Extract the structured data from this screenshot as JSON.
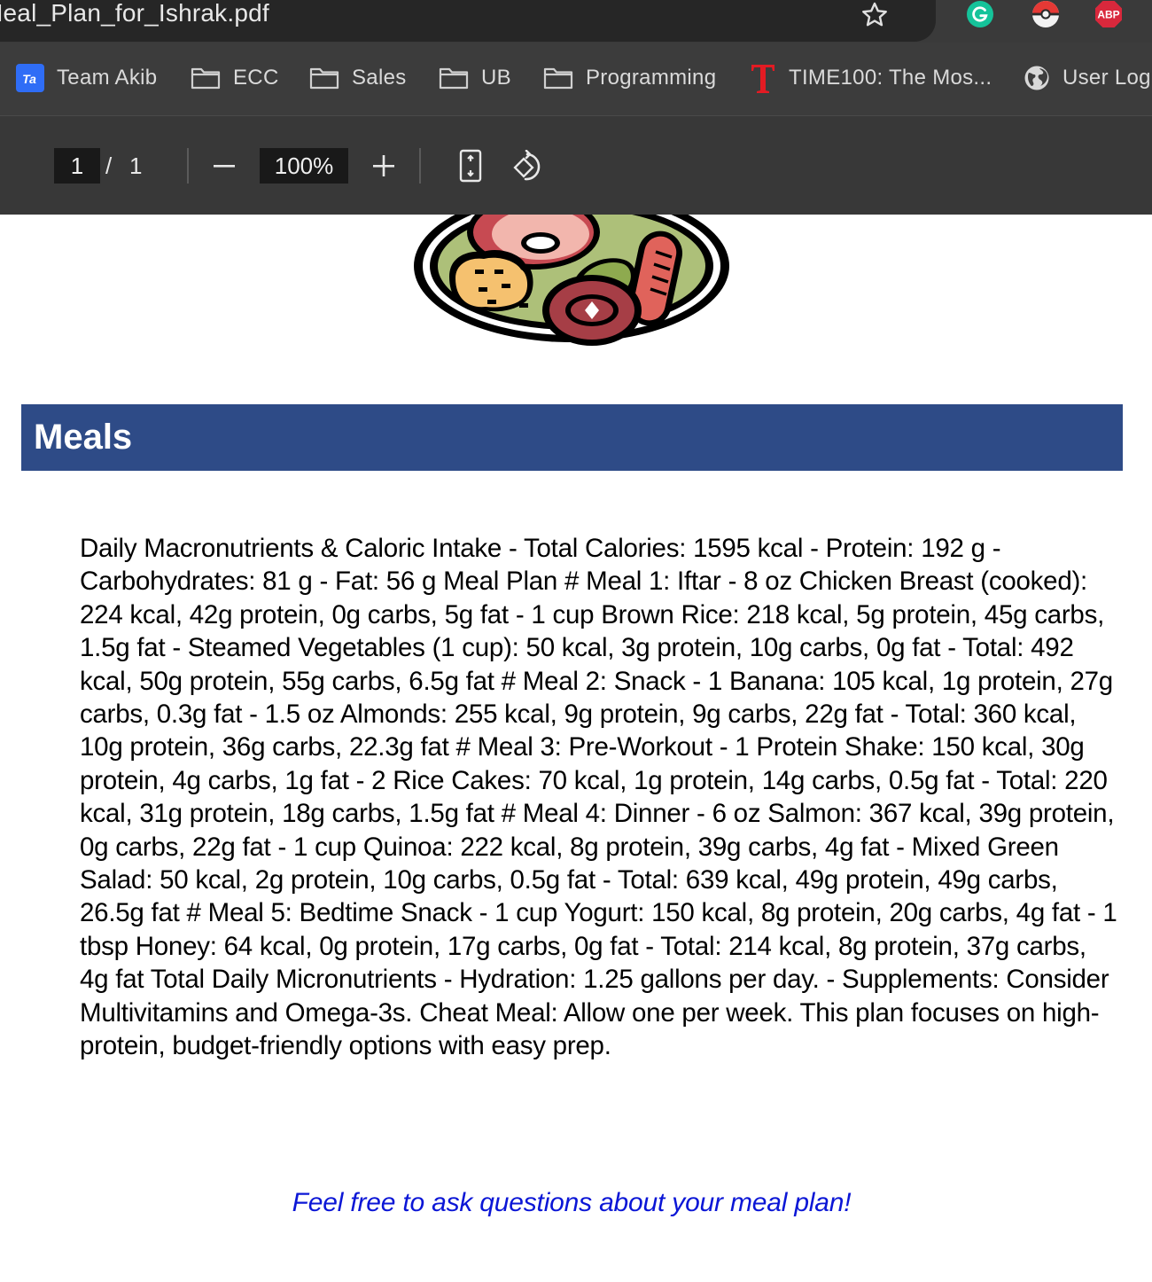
{
  "browser": {
    "address_text": "Meal_Plan_for_Ishrak.pdf",
    "extensions": {
      "grammarly": "G",
      "adblock": "ABP"
    }
  },
  "bookmarks": [
    {
      "label": "Team Akib",
      "icon": "team-akib-icon"
    },
    {
      "label": "ECC",
      "icon": "folder-icon"
    },
    {
      "label": "Sales",
      "icon": "folder-icon"
    },
    {
      "label": "UB",
      "icon": "folder-icon"
    },
    {
      "label": "Programming",
      "icon": "folder-icon"
    },
    {
      "label": "TIME100: The Mos...",
      "icon": "time-logo-icon"
    },
    {
      "label": "User Log",
      "icon": "globe-icon"
    }
  ],
  "pdf_toolbar": {
    "current_page": "1",
    "page_separator": "/",
    "total_pages": "1",
    "zoom": "100%"
  },
  "document": {
    "section_title": "Meals",
    "body": "Daily Macronutrients & Caloric Intake - Total Calories: 1595 kcal - Protein: 192 g - Carbohydrates: 81 g - Fat: 56 g Meal Plan # Meal 1: Iftar - 8 oz Chicken Breast (cooked): 224 kcal, 42g protein, 0g carbs, 5g fat - 1 cup Brown Rice: 218 kcal, 5g protein, 45g carbs, 1.5g fat - Steamed Vegetables (1 cup): 50 kcal, 3g protein, 10g carbs, 0g fat - Total: 492 kcal, 50g protein, 55g carbs, 6.5g fat # Meal 2: Snack - 1 Banana: 105 kcal, 1g protein, 27g carbs, 0.3g fat - 1.5 oz Almonds: 255 kcal, 9g protein, 9g carbs, 22g fat - Total: 360 kcal, 10g protein, 36g carbs, 22.3g fat # Meal 3: Pre-Workout - 1 Protein Shake: 150 kcal, 30g protein, 4g carbs, 1g fat - 2 Rice Cakes: 70 kcal, 1g protein, 14g carbs, 0.5g fat - Total: 220 kcal, 31g protein, 18g carbs, 1.5g fat # Meal 4: Dinner - 6 oz Salmon: 367 kcal, 39g protein, 0g carbs, 22g fat - 1 cup Quinoa: 222 kcal, 8g protein, 39g carbs, 4g fat - Mixed Green Salad: 50 kcal, 2g protein, 10g carbs, 0.5g fat - Total: 639 kcal, 49g protein, 49g carbs, 26.5g fat # Meal 5: Bedtime Snack - 1 cup Yogurt: 150 kcal, 8g protein, 20g carbs, 4g fat - 1 tbsp Honey: 64 kcal, 0g protein, 17g carbs, 0g fat - Total: 214 kcal, 8g protein, 37g carbs, 4g fat Total Daily Micronutrients - Hydration: 1.25 gallons per day. - Supplements: Consider Multivitamins and Omega-3s. Cheat Meal: Allow one per week. This plan focuses on high-protein, budget-friendly options with easy prep.",
    "closing": "Feel free to ask questions about your meal plan!"
  },
  "colors": {
    "banner": "#2e4b87",
    "closing_text": "#0b16d6",
    "chrome_dark": "#3c3c3c"
  }
}
